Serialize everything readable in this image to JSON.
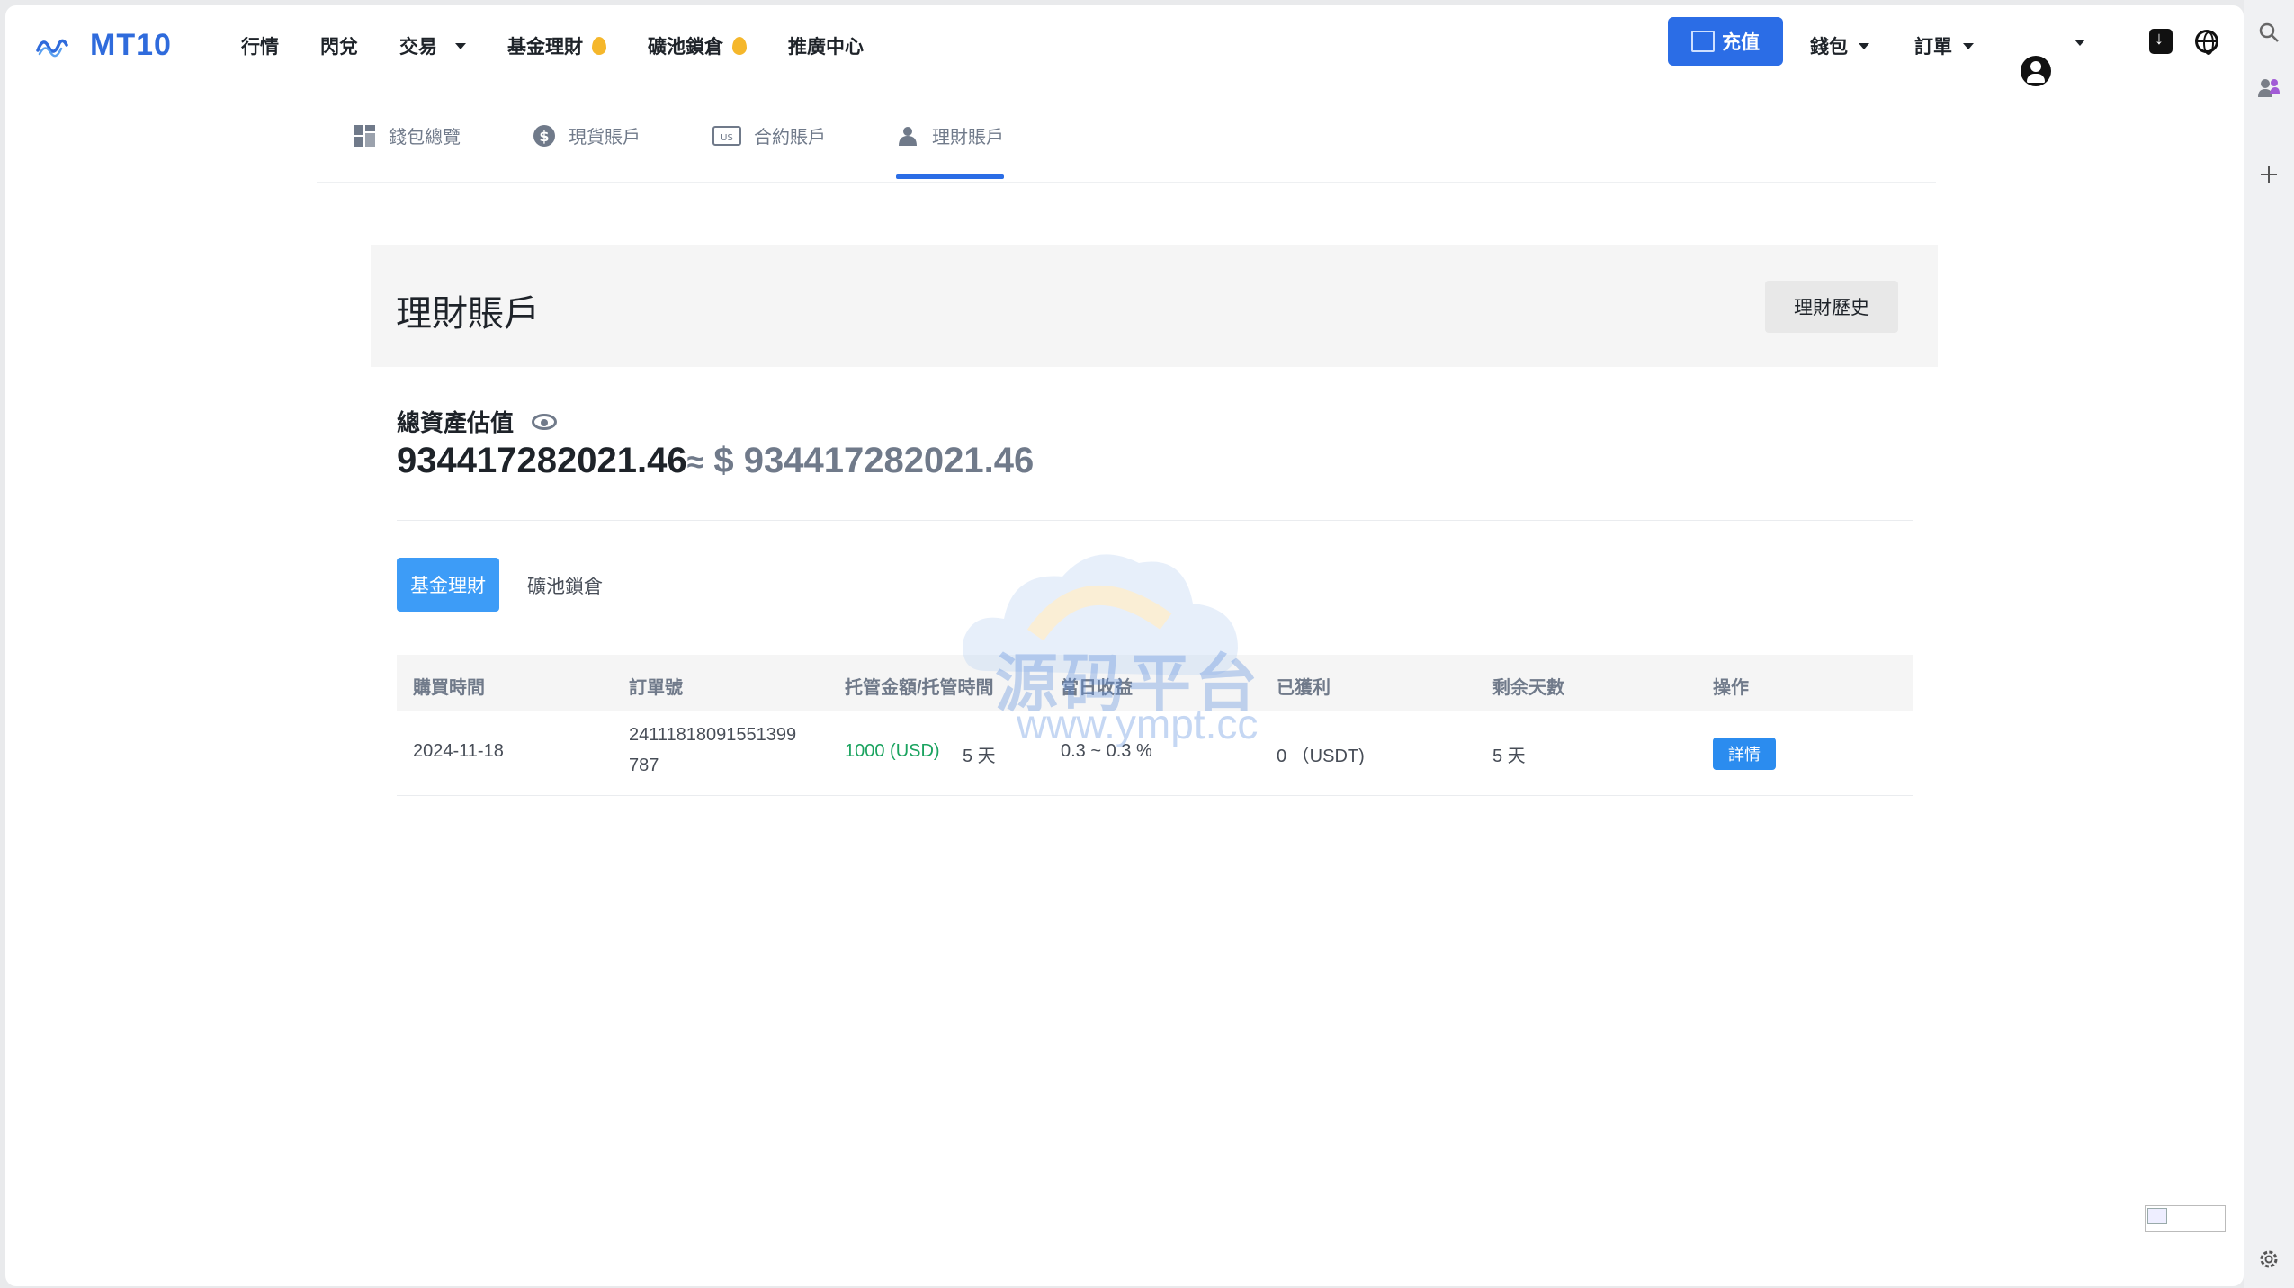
{
  "brand": {
    "name": "MT10",
    "logo_icon": "wave-logo-icon",
    "color": "#2f6bdc"
  },
  "nav": {
    "market": "行情",
    "swap": "閃兌",
    "trade": "交易",
    "fund": "基金理財",
    "pool": "礦池鎖倉",
    "referral": "推廣中心"
  },
  "header": {
    "deposit": "充值",
    "wallet": "錢包",
    "orders": "訂單"
  },
  "tabs": [
    {
      "label": "錢包總覽",
      "icon": "dashboard-icon"
    },
    {
      "label": "現貨賬戶",
      "icon": "dollar-circle-icon"
    },
    {
      "label": "合約賬戶",
      "icon": "us-badge-icon"
    },
    {
      "label": "理財賬戶",
      "icon": "piggy-bank-icon",
      "active": true
    }
  ],
  "panel": {
    "title": "理財賬戶",
    "history_button": "理財歷史"
  },
  "assets": {
    "label": "總資產估值",
    "value": "934417282021.46",
    "approx": "≈",
    "usd_value": "$ 934417282021.46"
  },
  "subtabs": {
    "active": "基金理財",
    "other": "礦池鎖倉"
  },
  "table": {
    "headers": [
      "購買時間",
      "訂單號",
      "托管金額/托管時間",
      "當日收益",
      "已獲利",
      "剩余天數",
      "操作"
    ],
    "rows": [
      {
        "date": "2024-11-18",
        "order_line1": "24111818091551399",
        "order_line2": "787",
        "amount": "1000 (USD)",
        "duration": "5 天",
        "daily": "0.3 ~ 0.3 %",
        "profit": "0 （USDT)",
        "remaining": "5 天",
        "action": "詳情"
      }
    ]
  },
  "watermark": {
    "text": "源码平台",
    "url": "www.ympt.cc"
  },
  "accent_color": "#2b6de6"
}
